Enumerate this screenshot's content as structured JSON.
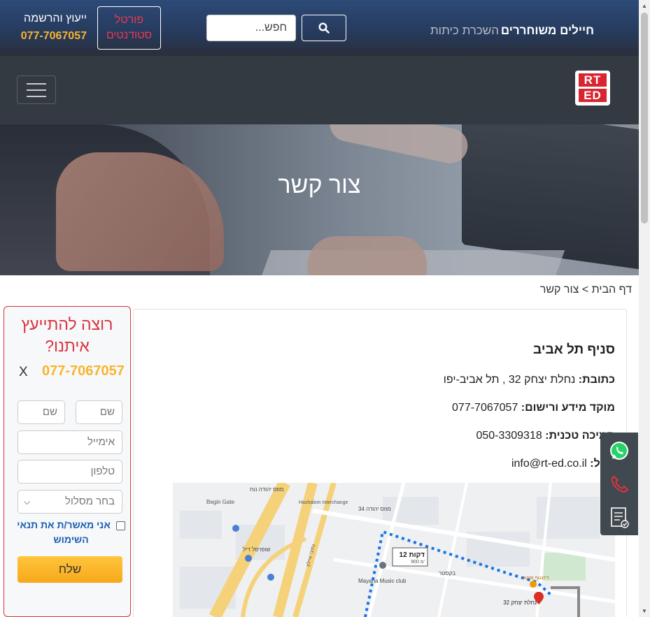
{
  "header": {
    "nav_soldiers": "חיילים משוחררים",
    "nav_rent": "השכרת כיתות",
    "search_placeholder": "חפש...",
    "portal_label": "פורטל סטודנטים",
    "consult_label": "ייעוץ והרשמה",
    "consult_phone": "077-7067057"
  },
  "logo": {
    "line1": "RT",
    "line2": "ED"
  },
  "hero": {
    "title": "צור קשר"
  },
  "breadcrumb": {
    "home": "דף הבית",
    "separator": ">",
    "current": "צור קשר"
  },
  "contact": {
    "branch_title": "סניף תל אביב",
    "address_label": "כתובת:",
    "address_value": "נחלת יצחק 32 , תל אביב-יפו",
    "info_label": "מוקד מידע ורישום:",
    "info_value": "077-7067057",
    "tech_label": "תמיכה טכנית:",
    "tech_value": "050-3309318",
    "mail_label": "מייל:",
    "mail_value": "info@rt-ed.co.il"
  },
  "map": {
    "duration": "12 דקות",
    "distance": "900 מ'",
    "pin_label": "נחלת יצחק 32",
    "labels": [
      "מוזס יהודה 34",
      "מוזס יהודה נוח",
      "Hashalom Interchange",
      "Begin Gate",
      "נתיבי איילון",
      "שופרסל דיל",
      "Mayana Music club",
      "בקסטר",
      "דיזנגוף סנטר"
    ]
  },
  "form": {
    "title": "רוצה להתייעץ איתנו?",
    "phone": "077-7067057",
    "close": "X",
    "first_name": "שם פרטי",
    "last_name": "שם משפחה",
    "first_display": "שם פרט",
    "last_display": "שם משו",
    "email": "אימייל",
    "tel": "טלפון",
    "track": "בחר מסלול",
    "terms": "אני מאשר/ת את תנאי השימוש",
    "submit": "שלח"
  },
  "colors": {
    "brand_red": "#d9252f",
    "accent_orange": "#f7b52c",
    "nav_blue": "#2d4a78"
  }
}
